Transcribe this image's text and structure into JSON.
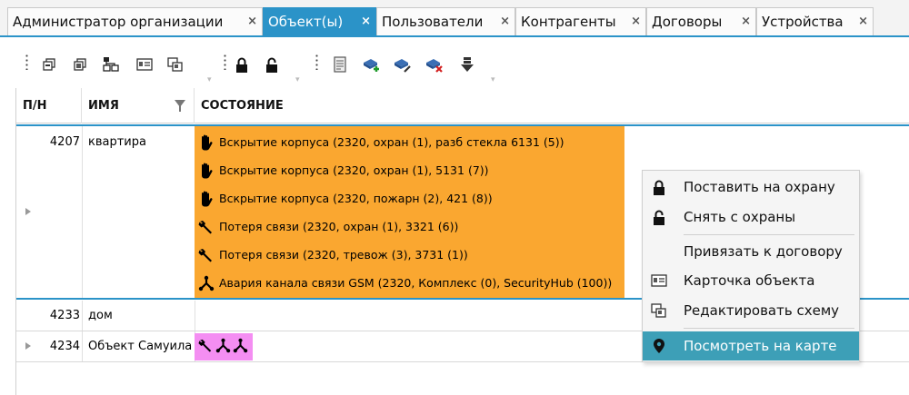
{
  "tabs": [
    {
      "label": "Администратор организации",
      "active": false
    },
    {
      "label": "Объект(ы)",
      "active": true
    },
    {
      "label": "Пользователи",
      "active": false
    },
    {
      "label": "Контрагенты",
      "active": false
    },
    {
      "label": "Договоры",
      "active": false
    },
    {
      "label": "Устройства",
      "active": false
    }
  ],
  "tab_close_glyph": "×",
  "toolbar": {
    "buttons": [
      "copy-icon",
      "copy-alt-icon",
      "network-icon",
      "card-icon",
      "schema-icon",
      "lock-closed-icon",
      "lock-open-icon",
      "report-icon",
      "add-device-icon",
      "edit-device-icon",
      "remove-device-icon",
      "download-icon"
    ]
  },
  "grid": {
    "columns": [
      "П/Н",
      "ИМЯ",
      "СОСТОЯНИЕ"
    ],
    "rows": [
      {
        "num": "4207",
        "name": "квартира",
        "statuses": [
          {
            "icon": "hand-icon",
            "text": "Вскрытие корпуса (2320, охран (1), разб стекла 6131 (5))"
          },
          {
            "icon": "hand-icon",
            "text": "Вскрытие корпуса (2320, охран (1), 5131 (7))"
          },
          {
            "icon": "hand-icon",
            "text": "Вскрытие корпуса (2320, пожарн (2), 421 (8))"
          },
          {
            "icon": "wrench-icon",
            "text": "Потеря связи (2320, охран (1), 3321 (6))"
          },
          {
            "icon": "wrench-icon",
            "text": "Потеря связи (2320, тревож (3), 3731 (1))"
          },
          {
            "icon": "network-fault-icon",
            "text": "Авария канала связи GSM (2320, Комплекс (0), SecurityHub (100))"
          }
        ]
      },
      {
        "num": "4233",
        "name": "дом"
      },
      {
        "num": "4234",
        "name": "Объект Самуила",
        "badges": [
          "wrench-icon",
          "network-fault-icon",
          "network-fault-icon"
        ]
      }
    ]
  },
  "context_menu": {
    "items": [
      {
        "icon": "lock-closed-icon",
        "label": "Поставить на охрану"
      },
      {
        "icon": "lock-open-icon",
        "label": "Снять с охраны"
      },
      {
        "icon": "",
        "label": "Привязать к договору"
      },
      {
        "icon": "card-icon",
        "label": "Карточка объекта"
      },
      {
        "icon": "schema-icon",
        "label": "Редактировать схему"
      },
      {
        "icon": "map-pin-icon",
        "label": "Посмотреть на карте",
        "highlighted": true
      }
    ]
  },
  "colors": {
    "accent": "#2b93c8",
    "alarm_status": "#faa730",
    "fault_badge": "#f48ef2",
    "menu_highlight": "#3d9fb7"
  }
}
